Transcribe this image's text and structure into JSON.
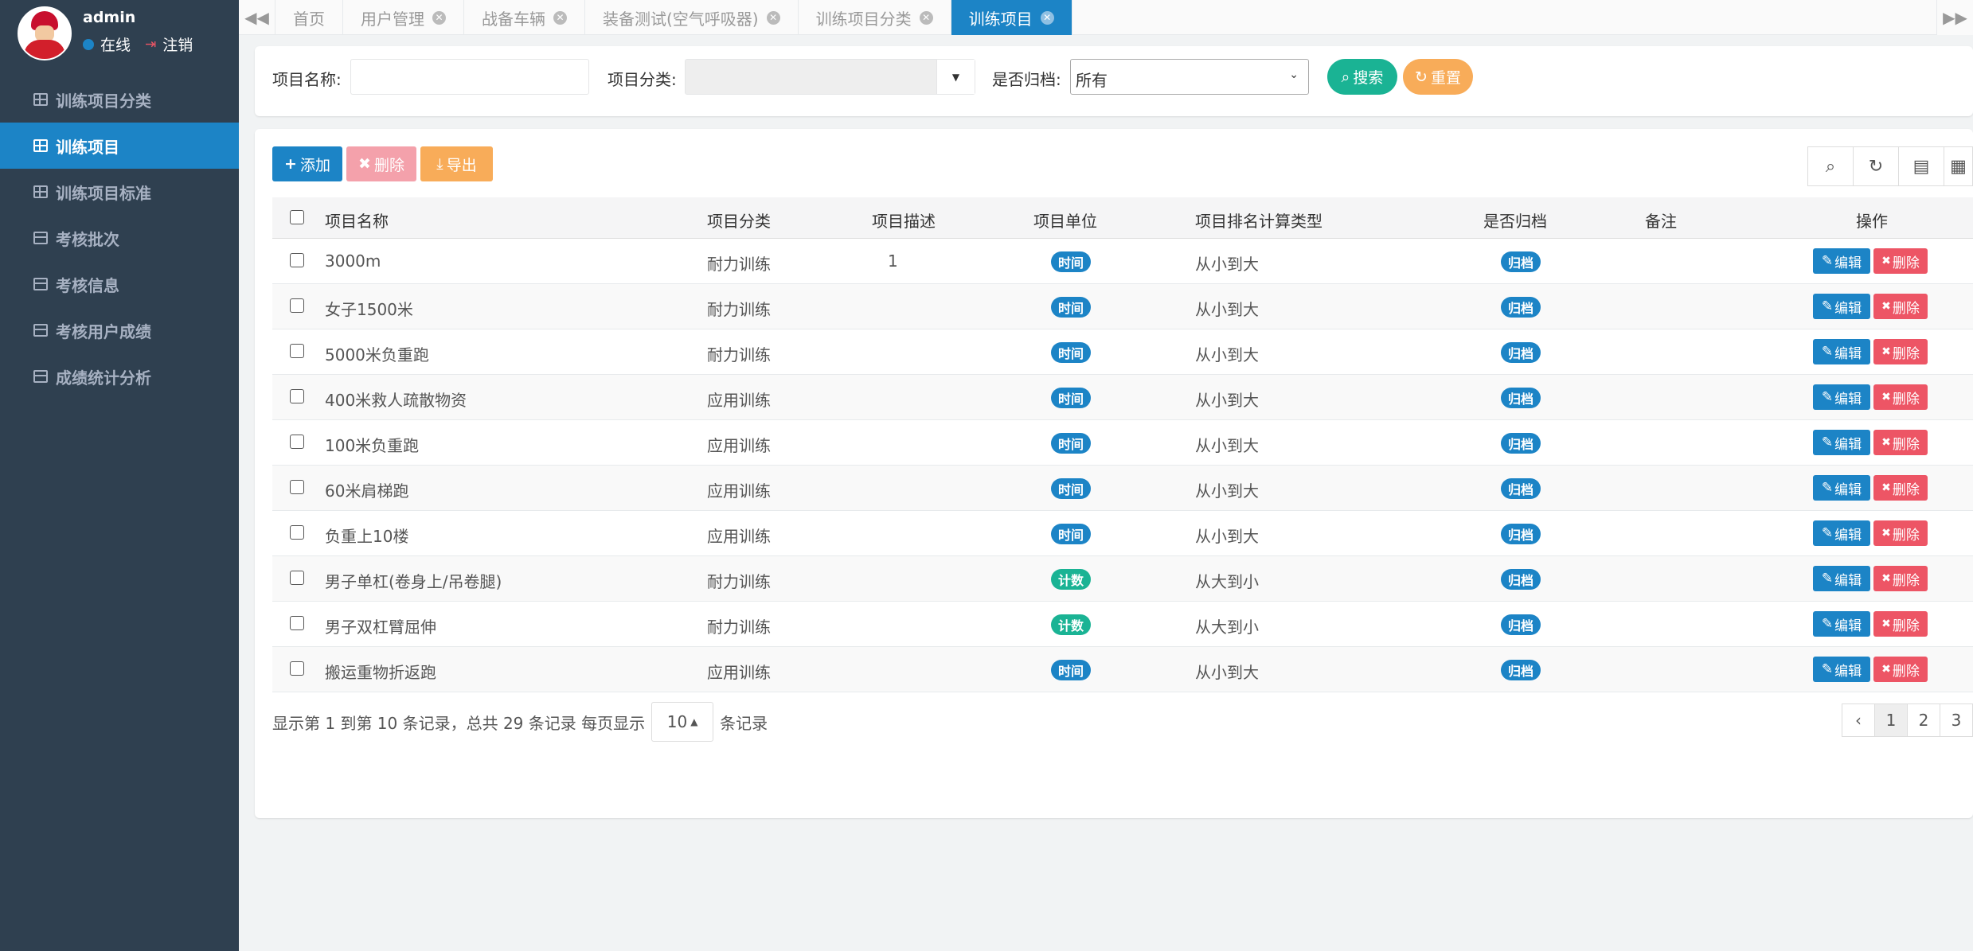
{
  "profile": {
    "name": "admin",
    "status": "在线",
    "logout": "注销"
  },
  "sidebar": {
    "items": [
      {
        "label": "训练项目分类"
      },
      {
        "label": "训练项目"
      },
      {
        "label": "训练项目标准"
      },
      {
        "label": "考核批次"
      },
      {
        "label": "考核信息"
      },
      {
        "label": "考核用户成绩"
      },
      {
        "label": "成绩统计分析"
      }
    ]
  },
  "tabs": [
    {
      "label": "首页"
    },
    {
      "label": "用户管理"
    },
    {
      "label": "战备车辆"
    },
    {
      "label": "装备测试(空气呼吸器)"
    },
    {
      "label": "训练项目分类"
    },
    {
      "label": "训练项目"
    }
  ],
  "search": {
    "name_label": "项目名称:",
    "name_value": "",
    "category_label": "项目分类:",
    "archived_label": "是否归档:",
    "archived_value": "所有",
    "search_btn": "搜索",
    "reset_btn": "重置"
  },
  "toolbar": {
    "add": "添加",
    "delete": "删除",
    "export": "导出"
  },
  "table": {
    "headers": [
      "项目名称",
      "项目分类",
      "项目描述",
      "项目单位",
      "项目排名计算类型",
      "是否归档",
      "备注",
      "操作"
    ],
    "edit_label": "编辑",
    "delete_label": "删除",
    "rows": [
      {
        "name": "3000m",
        "category": "耐力训练",
        "desc": "1",
        "unit": "时间",
        "rank": "从小到大",
        "archived": "归档"
      },
      {
        "name": "女子1500米",
        "category": "耐力训练",
        "desc": "",
        "unit": "时间",
        "rank": "从小到大",
        "archived": "归档"
      },
      {
        "name": "5000米负重跑",
        "category": "耐力训练",
        "desc": "",
        "unit": "时间",
        "rank": "从小到大",
        "archived": "归档"
      },
      {
        "name": "400米救人疏散物资",
        "category": "应用训练",
        "desc": "",
        "unit": "时间",
        "rank": "从小到大",
        "archived": "归档"
      },
      {
        "name": "100米负重跑",
        "category": "应用训练",
        "desc": "",
        "unit": "时间",
        "rank": "从小到大",
        "archived": "归档"
      },
      {
        "name": "60米肩梯跑",
        "category": "应用训练",
        "desc": "",
        "unit": "时间",
        "rank": "从小到大",
        "archived": "归档"
      },
      {
        "name": "负重上10楼",
        "category": "应用训练",
        "desc": "",
        "unit": "时间",
        "rank": "从小到大",
        "archived": "归档"
      },
      {
        "name": "男子单杠(卷身上/吊卷腿)",
        "category": "耐力训练",
        "desc": "",
        "unit": "计数",
        "rank": "从大到小",
        "archived": "归档"
      },
      {
        "name": "男子双杠臂屈伸",
        "category": "耐力训练",
        "desc": "",
        "unit": "计数",
        "rank": "从大到小",
        "archived": "归档"
      },
      {
        "name": "搬运重物折返跑",
        "category": "应用训练",
        "desc": "",
        "unit": "时间",
        "rank": "从小到大",
        "archived": "归档"
      }
    ]
  },
  "pagination": {
    "info_prefix": "显示第 1 到第 10 条记录，总共 29 条记录  每页显示",
    "page_size": "10",
    "info_suffix": "条记录",
    "prev": "‹",
    "pages": [
      "1",
      "2",
      "3"
    ]
  },
  "colors": {
    "sidebar_bg": "#2f4050",
    "primary": "#1c84c6",
    "success": "#1ab394",
    "warning": "#f8ac59",
    "danger": "#ed5565"
  }
}
